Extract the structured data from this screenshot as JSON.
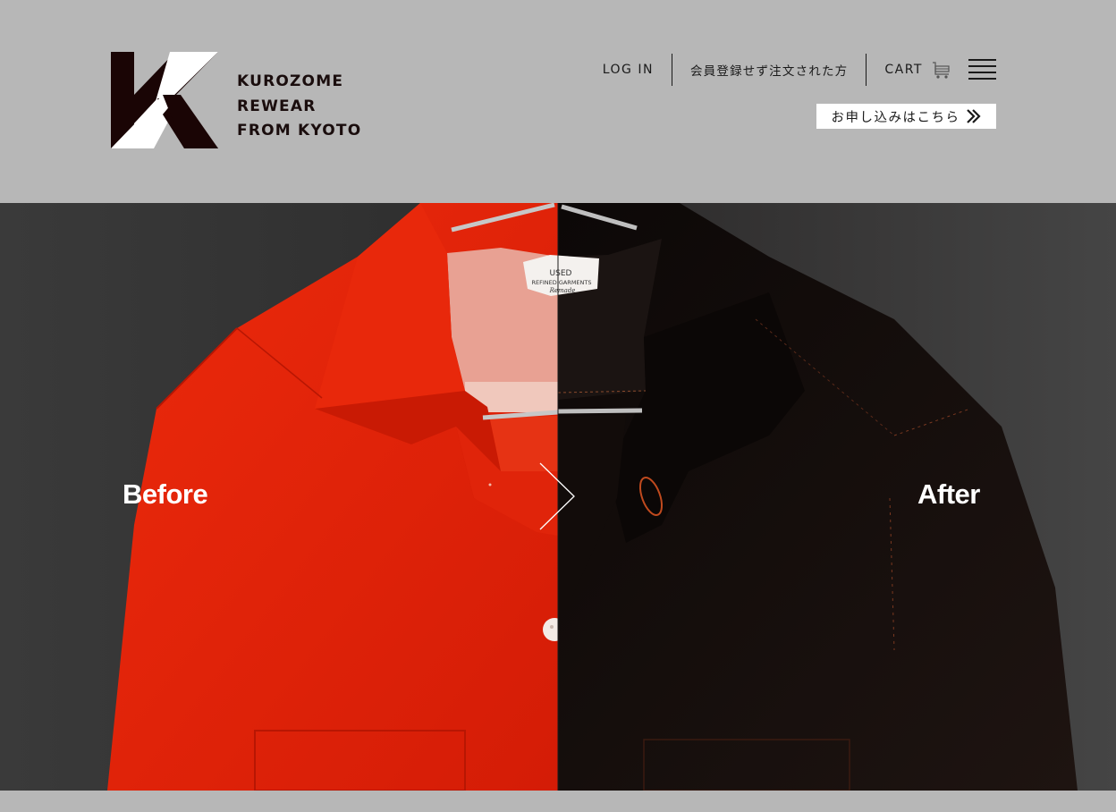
{
  "brand": {
    "logo_lines": [
      "KUROZOME",
      "REWEAR",
      "FROM KYOTO"
    ],
    "colors": {
      "logo_dark": "#1a0505",
      "header_bg": "#b7b7b7",
      "before_garment": "#e0230a",
      "after_garment": "#140d0b"
    }
  },
  "nav": {
    "login_label": "LOG IN",
    "guest_order_label": "会員登録せず注文された方",
    "cart_label": "CART",
    "cart_icon": "cart-icon",
    "menu_icon": "hamburger-menu-icon"
  },
  "apply": {
    "label": "お申し込みはこちら",
    "icon": "double-chevron-right-icon"
  },
  "hero": {
    "before_label": "Before",
    "after_label": "After",
    "divider_icon": "chevron-right-icon",
    "garment_tag": {
      "line1": "USED",
      "line2": "REFINED GARMENTS",
      "line3": "Remade"
    }
  }
}
